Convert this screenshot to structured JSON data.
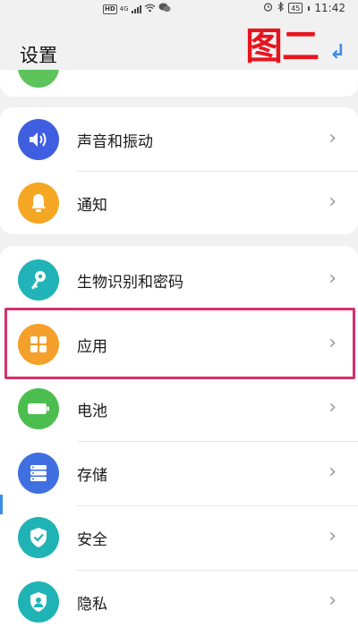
{
  "status_bar": {
    "hd": "HD",
    "network": "4G",
    "battery": "45",
    "time": "11:42",
    "icons": [
      "hd-icon",
      "signal-icon",
      "wifi-icon",
      "wechat-icon",
      "alarm-icon",
      "bluetooth-icon",
      "battery-icon"
    ]
  },
  "header": {
    "title": "设置"
  },
  "annotation": {
    "text": "图二",
    "arrow": "↲",
    "text_color": "#e8141e",
    "arrow_color": "#3a8ee6"
  },
  "settings": {
    "group1": [
      {
        "label": "声音和振动",
        "icon": "volume-icon",
        "color": "#3f5fe0"
      },
      {
        "label": "通知",
        "icon": "bell-icon",
        "color": "#f5a623"
      }
    ],
    "group2": [
      {
        "label": "生物识别和密码",
        "icon": "key-icon",
        "color": "#22b3b8"
      },
      {
        "label": "应用",
        "icon": "apps-grid-icon",
        "color": "#f5a02a"
      },
      {
        "label": "电池",
        "icon": "battery-icon",
        "color": "#4cbe4f"
      },
      {
        "label": "存储",
        "icon": "storage-icon",
        "color": "#3f6fe0"
      },
      {
        "label": "安全",
        "icon": "shield-icon",
        "color": "#1fb3b5"
      },
      {
        "label": "隐私",
        "icon": "privacy-icon",
        "color": "#1fb3b5"
      }
    ],
    "chevron": "›"
  },
  "highlight": {
    "target": "应用",
    "border_color": "#d4316d"
  }
}
